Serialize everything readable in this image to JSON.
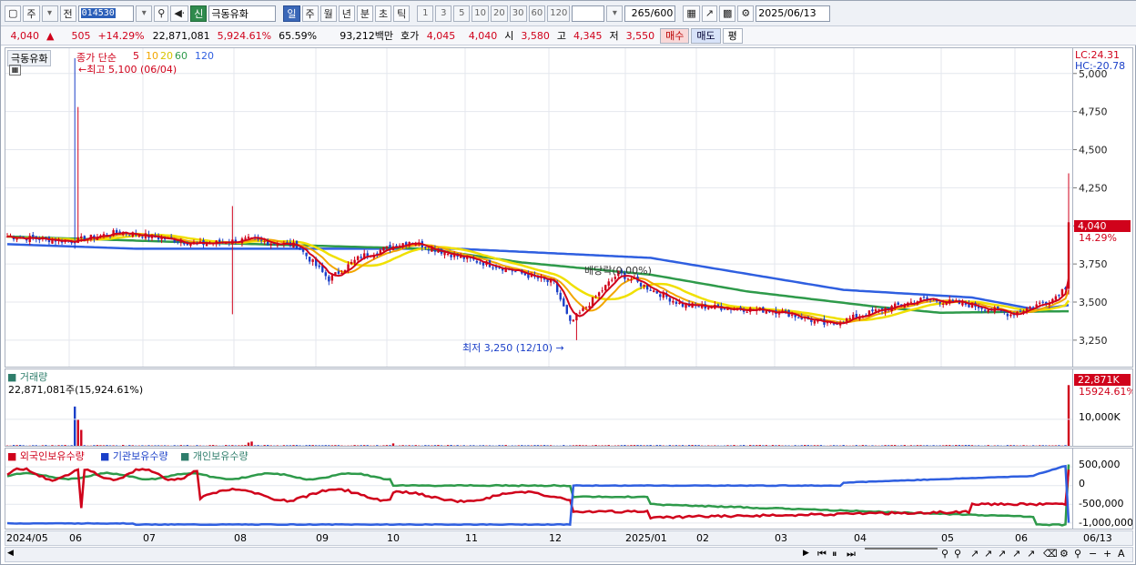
{
  "toolbar": {
    "type_label": "주",
    "prev_label": "전",
    "code": "014530",
    "market_badge": "신",
    "stock_name": "극동유화",
    "periods": [
      "일",
      "주",
      "월",
      "년",
      "분",
      "초",
      "틱"
    ],
    "active_period": "일",
    "intervals": [
      "1",
      "3",
      "5",
      "10",
      "20",
      "30",
      "60",
      "120"
    ],
    "count": "265",
    "count_total": "/600",
    "date": "2025/06/13"
  },
  "quote": {
    "price": "4,040",
    "arrow": "▲",
    "change": "505",
    "change_pct": "+14.29%",
    "volume": "22,871,081",
    "volume_pct": "5,924.61%",
    "rate": "65.59%",
    "amount": "93,212백만",
    "ask_label": "호가",
    "ask1": "4,045",
    "ask2": "4,040",
    "open_label": "시",
    "open": "3,580",
    "high_label": "고",
    "high": "4,345",
    "low_label": "저",
    "low": "3,550",
    "buy_label": "매수",
    "sell_label": "매도",
    "eval_label": "평"
  },
  "price_pane": {
    "name_tag": "극동유화",
    "ma_title": "종가 단순",
    "ma_periods": [
      "5",
      "10",
      "20",
      "60",
      "120"
    ],
    "high_note": "최고 5,100 (06/04)",
    "low_note": "최저 3,250 (12/10)",
    "dividend_note": "배당락(0.00%)",
    "lc": "LC:24.31",
    "hc": "HC:-20.78",
    "last_price_tag": "4,040",
    "last_pct_tag": "14.29%"
  },
  "volume_pane": {
    "title": "거래량",
    "value_note": "22,871,081주(15,924.61%)",
    "last_tag": "22,871K",
    "last_pct": "15924.61%",
    "tick": "10,000K"
  },
  "holding_pane": {
    "legend": [
      "외국인보유수량",
      "기관보유수량",
      "개인보유수량"
    ],
    "ticks": [
      "500,000",
      "0",
      "-500,000",
      "-1,000,000"
    ]
  },
  "x_labels": [
    "2024/05",
    "06",
    "07",
    "08",
    "09",
    "10",
    "11",
    "12",
    "2025/01",
    "02",
    "03",
    "04",
    "05",
    "06",
    "06/13"
  ],
  "colors": {
    "up": "#d0021b",
    "down": "#1a3fc8",
    "ma5": "#d0021b",
    "ma10": "#f2a600",
    "ma20": "#f0e000",
    "ma60": "#2e9a4a",
    "ma120": "#2f5fe0",
    "foreign": "#d0021b",
    "institution": "#2f5fe0",
    "individual": "#2e9a4a"
  },
  "chart_data": {
    "type": "candlestick",
    "y_ticks": [
      5000,
      4750,
      4500,
      4250,
      4000,
      3750,
      3500,
      3250
    ],
    "ylim": [
      3100,
      5130
    ],
    "anchors_ma120": [
      [
        0,
        3880
      ],
      [
        40,
        3850
      ],
      [
        140,
        3850
      ],
      [
        200,
        3790
      ],
      [
        260,
        3580
      ],
      [
        300,
        3530
      ],
      [
        320,
        3450
      ],
      [
        330,
        3480
      ]
    ],
    "anchors_ma60": [
      [
        0,
        3930
      ],
      [
        60,
        3890
      ],
      [
        130,
        3850
      ],
      [
        160,
        3760
      ],
      [
        200,
        3680
      ],
      [
        230,
        3570
      ],
      [
        270,
        3470
      ],
      [
        290,
        3430
      ],
      [
        330,
        3440
      ]
    ],
    "anchors_close": [
      [
        0,
        3930
      ],
      [
        20,
        3900
      ],
      [
        35,
        3960
      ],
      [
        60,
        3880
      ],
      [
        75,
        3910
      ],
      [
        90,
        3870
      ],
      [
        100,
        3650
      ],
      [
        110,
        3800
      ],
      [
        125,
        3900
      ],
      [
        140,
        3800
      ],
      [
        155,
        3720
      ],
      [
        170,
        3620
      ],
      [
        175,
        3360
      ],
      [
        190,
        3690
      ],
      [
        210,
        3480
      ],
      [
        240,
        3440
      ],
      [
        255,
        3350
      ],
      [
        270,
        3440
      ],
      [
        285,
        3520
      ],
      [
        300,
        3480
      ],
      [
        312,
        3420
      ],
      [
        325,
        3520
      ],
      [
        329,
        3600
      ],
      [
        330,
        4040
      ]
    ],
    "volume_spikes": [
      [
        21,
        14800
      ],
      [
        22,
        9800
      ],
      [
        23,
        6000
      ],
      [
        75,
        1200
      ],
      [
        76,
        1600
      ],
      [
        120,
        900
      ],
      [
        330,
        22871
      ]
    ],
    "holding_ticks": [
      500000,
      0,
      -500000,
      -1000000
    ]
  }
}
